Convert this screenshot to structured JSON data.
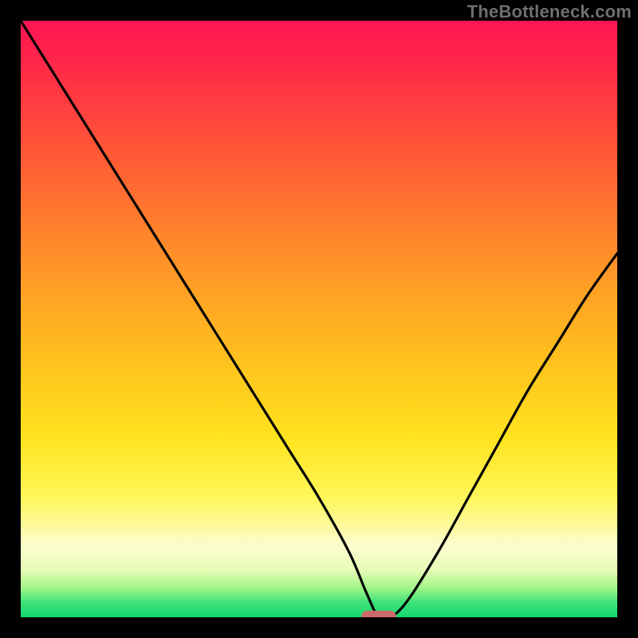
{
  "watermark": "TheBottleneck.com",
  "colors": {
    "page_bg": "#000000",
    "curve": "#000000",
    "marker": "#cc6a6a",
    "gradient_stops": [
      "#ff1452",
      "#ff2a48",
      "#ff5736",
      "#ff7e2d",
      "#ffa324",
      "#ffc41e",
      "#ffe31e",
      "#fff75a",
      "#fdfccf",
      "#e8fcb6",
      "#a4f58a",
      "#3fe27a",
      "#14d96e"
    ]
  },
  "chart_data": {
    "type": "line",
    "title": "",
    "xlabel": "",
    "ylabel": "",
    "xlim": [
      0,
      100
    ],
    "ylim": [
      0,
      100
    ],
    "grid": false,
    "legend": false,
    "series": [
      {
        "name": "curve",
        "x": [
          0,
          5,
          10,
          15,
          20,
          25,
          30,
          35,
          40,
          45,
          50,
          55,
          58,
          60,
          62,
          65,
          70,
          75,
          80,
          85,
          90,
          95,
          100
        ],
        "values": [
          100,
          92,
          84,
          76,
          68,
          60,
          52,
          44,
          36,
          28,
          20,
          11,
          4,
          0,
          0,
          3,
          11,
          20,
          29,
          38,
          46,
          54,
          61
        ]
      }
    ],
    "marker": {
      "x": 60,
      "y": 0
    },
    "annotations": []
  }
}
